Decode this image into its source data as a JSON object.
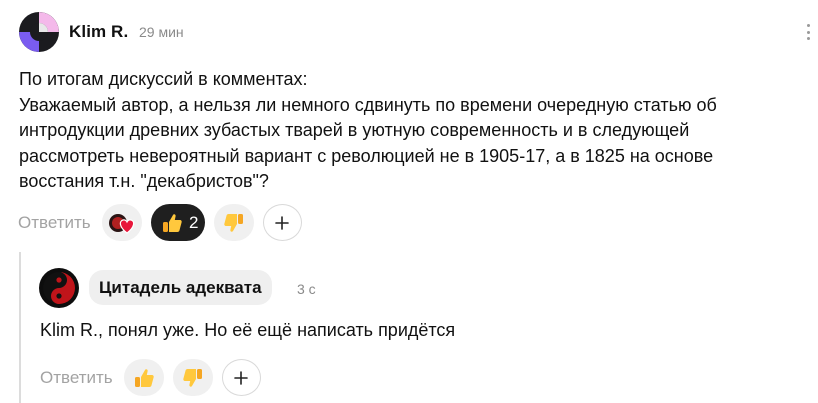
{
  "comment": {
    "author": "Klim R.",
    "time": "29 мин",
    "text": "По итогам дискуссий в комментах:\nУважаемый автор, а нельзя ли немного сдвинуть по времени очередную статью об\nинтродукции древних зубастых тварей в уютную современность и в следующей\nрассмотреть невероятный вариант с революцией не в 1905-17, а в 1825 на основе\nвосстания т.н. \"декабристов\"?",
    "reply_label": "Ответить",
    "like_count": "2",
    "icons": [
      "heart-reaction-icon",
      "thumbs-up-icon",
      "thumbs-down-icon",
      "plus-icon",
      "more-vertical-icon"
    ]
  },
  "reply": {
    "author": "Цитадель адеквата",
    "time": "3 с",
    "text": "Klim R., понял уже. Но её ещё написать придётся",
    "reply_label": "Ответить",
    "icons": [
      "thumbs-up-icon",
      "thumbs-down-icon",
      "plus-icon"
    ]
  }
}
